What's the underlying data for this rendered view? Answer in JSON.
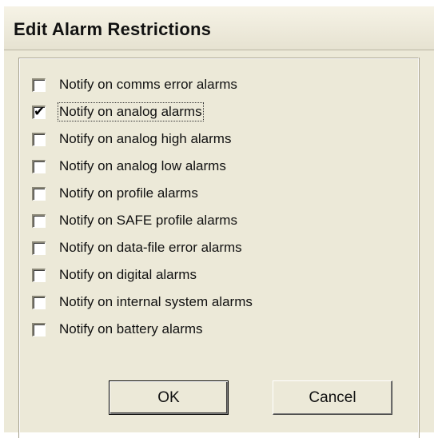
{
  "dialog": {
    "title": "Edit Alarm Restrictions"
  },
  "options": [
    {
      "label": "Notify on comms error alarms",
      "checked": false
    },
    {
      "label": "Notify on analog alarms",
      "checked": true
    },
    {
      "label": "Notify on analog high alarms",
      "checked": false
    },
    {
      "label": "Notify on analog low alarms",
      "checked": false
    },
    {
      "label": "Notify on profile alarms",
      "checked": false
    },
    {
      "label": "Notify on SAFE profile alarms",
      "checked": false
    },
    {
      "label": "Notify on data-file error alarms",
      "checked": false
    },
    {
      "label": "Notify on digital alarms",
      "checked": false
    },
    {
      "label": "Notify on internal system alarms",
      "checked": false
    },
    {
      "label": "Notify on battery alarms",
      "checked": false
    }
  ],
  "buttons": {
    "ok_label": "OK",
    "cancel_label": "Cancel"
  }
}
